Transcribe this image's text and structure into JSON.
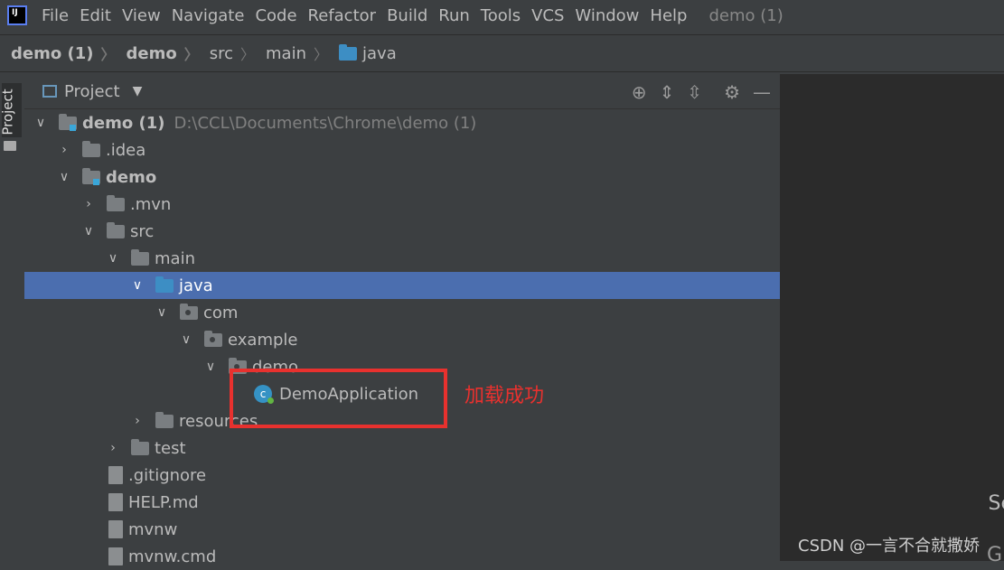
{
  "menubar": {
    "items": [
      "File",
      "Edit",
      "View",
      "Navigate",
      "Code",
      "Refactor",
      "Build",
      "Run",
      "Tools",
      "VCS",
      "Window",
      "Help"
    ],
    "window_title": "demo (1)"
  },
  "breadcrumb": [
    "demo (1)",
    "demo",
    "src",
    "main",
    "java"
  ],
  "side_tab": {
    "label": "Project"
  },
  "project_panel": {
    "title": "Project"
  },
  "tree": [
    {
      "label": "demo (1)",
      "path": "D:\\CCL\\Documents\\Chrome\\demo (1)"
    },
    {
      "label": ".idea"
    },
    {
      "label": "demo"
    },
    {
      "label": ".mvn"
    },
    {
      "label": "src"
    },
    {
      "label": "main"
    },
    {
      "label": "java"
    },
    {
      "label": "com"
    },
    {
      "label": "example"
    },
    {
      "label": "demo"
    },
    {
      "label": "DemoApplication"
    },
    {
      "label": "resources"
    },
    {
      "label": "test"
    },
    {
      "label": ".gitignore"
    },
    {
      "label": "HELP.md"
    },
    {
      "label": "mvnw"
    },
    {
      "label": "mvnw.cmd"
    }
  ],
  "annotation": "加载成功",
  "editor_partial": {
    "text1": "Se",
    "text2": "G"
  },
  "watermark": "CSDN @一言不合就撒娇",
  "colors": {
    "selection": "#4b6eaf",
    "highlight_box": "#e8312e",
    "annotation": "#e8312e"
  }
}
